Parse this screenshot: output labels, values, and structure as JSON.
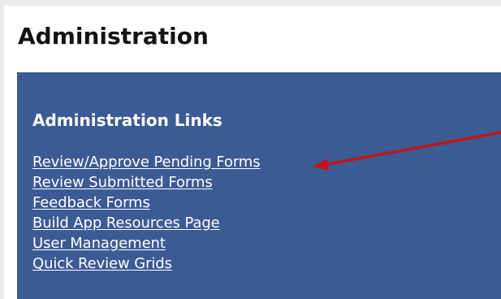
{
  "page": {
    "title": "Administration"
  },
  "panel": {
    "heading": "Administration Links",
    "background_color": "#3b5b94",
    "links": [
      {
        "label": "Review/Approve Pending Forms"
      },
      {
        "label": "Review Submitted Forms"
      },
      {
        "label": "Feedback Forms"
      },
      {
        "label": "Build App Resources Page"
      },
      {
        "label": "User Management"
      },
      {
        "label": "Quick Review Grids"
      }
    ]
  },
  "annotation": {
    "arrow_color": "#c0151c",
    "arrow_target": "Review/Approve Pending Forms"
  }
}
